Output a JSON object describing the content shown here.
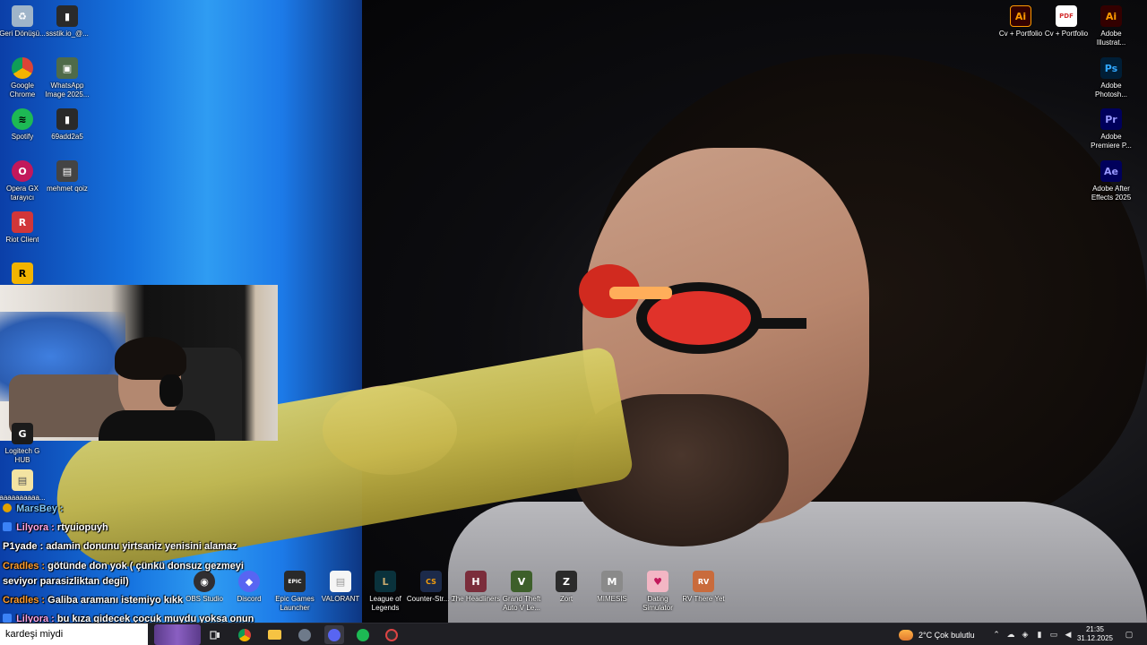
{
  "desktop_icons_left": [
    {
      "id": "recycle-bin",
      "label": "Geri Dönüşü...",
      "color": "#9fb4c9",
      "glyph": "♻"
    },
    {
      "id": "ssstik",
      "label": "ssstik.io_@...",
      "color": "#2a2a2a",
      "glyph": "▮"
    },
    {
      "id": "chrome",
      "label": "Google Chrome",
      "color": "#dd4b39",
      "glyph": "●"
    },
    {
      "id": "whatsapp-image",
      "label": "WhatsApp Image 2025...",
      "color": "#4f6b4a",
      "glyph": "▣"
    },
    {
      "id": "spotify",
      "label": "Spotify",
      "color": "#1db954",
      "glyph": "≋"
    },
    {
      "id": "image-69add2a5",
      "label": "69add2a5",
      "color": "#2a2a2a",
      "glyph": "▮"
    },
    {
      "id": "opera-gx",
      "label": "Opera GX tarayıcı",
      "color": "#c2185b",
      "glyph": "O"
    },
    {
      "id": "mehmet-qoiz",
      "label": "mehmet qoiz",
      "color": "#444",
      "glyph": "▤"
    },
    {
      "id": "riot-client",
      "label": "Riot Client",
      "color": "#d13639",
      "glyph": "R"
    },
    {
      "id": "rockstar",
      "label": "",
      "color": "#f2b400",
      "glyph": "R"
    },
    {
      "id": "logitech-ghub",
      "label": "Logitech G HUB",
      "color": "#1b1b1b",
      "glyph": "G"
    },
    {
      "id": "text-file",
      "label": "aaaaaaaaaa...",
      "color": "#f3e3a2",
      "glyph": "▤"
    }
  ],
  "desktop_icons_right": [
    {
      "id": "cv-portfolio-ai",
      "label": "Cv + Portfolio",
      "color": "#ff7c00",
      "glyph": "Ai"
    },
    {
      "id": "cv-portfolio-pdf",
      "label": "Cv + Portfolio",
      "color": "#d32f2f",
      "glyph": "PDF"
    },
    {
      "id": "adobe-illustrator",
      "label": "Adobe Illustrat...",
      "color": "#ff9a00",
      "glyph": "Ai"
    },
    {
      "id": "adobe-photoshop",
      "label": "Adobe Photosh...",
      "color": "#31a8ff",
      "glyph": "Ps"
    },
    {
      "id": "adobe-premiere",
      "label": "Adobe Premiere P...",
      "color": "#9999ff",
      "glyph": "Pr"
    },
    {
      "id": "adobe-after-effects",
      "label": "Adobe After Effects 2025",
      "color": "#9999ff",
      "glyph": "Ae"
    }
  ],
  "desktop_icons_bottom": [
    {
      "id": "obs-studio",
      "label": "OBS Studio",
      "color": "#302e31",
      "glyph": "◉"
    },
    {
      "id": "discord",
      "label": "Discord",
      "color": "#5865f2",
      "glyph": "◆"
    },
    {
      "id": "epic-games",
      "label": "Epic Games Launcher",
      "color": "#2a2a2a",
      "glyph": "EPIC"
    },
    {
      "id": "valorant",
      "label": "VALORANT",
      "color": "#f5f5f5",
      "glyph": "▤"
    },
    {
      "id": "league-of-legends",
      "label": "League of Legends",
      "color": "#0a323c",
      "glyph": "L"
    },
    {
      "id": "counter-strike-2",
      "label": "Counter-Str... 2",
      "color": "#f59e0b",
      "glyph": "CS"
    },
    {
      "id": "the-headliners",
      "label": "The Headliners",
      "color": "#7b2d3b",
      "glyph": "H"
    },
    {
      "id": "gta-v",
      "label": "Grand Theft Auto V Le...",
      "color": "#3d5f2a",
      "glyph": "V"
    },
    {
      "id": "zort",
      "label": "Zort",
      "color": "#2b2b2b",
      "glyph": "Z"
    },
    {
      "id": "mimesis",
      "label": "MIMESIS",
      "color": "#8a8a8a",
      "glyph": "M"
    },
    {
      "id": "dating-simulator",
      "label": "Dating Simulator",
      "color": "#f3b6c4",
      "glyph": "♥"
    },
    {
      "id": "rv-there-yet",
      "label": "RV There Yet",
      "color": "#c96b3c",
      "glyph": "RV"
    }
  ],
  "chat": [
    {
      "user": "MarsBey :",
      "user_color": "#7ec8ff",
      "badge_color": "#e0a100",
      "message": ""
    },
    {
      "user": "Lilyora :",
      "user_color": "#ffa6e6",
      "badge_color": "#3b82f6",
      "message": "rtyuiopuyh"
    },
    {
      "user": "P1yade :",
      "user_color": "#ffffff",
      "badge_color": "",
      "message": "adamin donunu yirtsaniz yenisini alamaz"
    },
    {
      "user": "Cradles :",
      "user_color": "#ff9d2e",
      "badge_color": "",
      "message": "götünde don yok ( çünkü donsuz gezmeyi"
    },
    {
      "user": "",
      "user_color": "#ffffff",
      "badge_color": "",
      "message": "seviyor parasizliktan degil)"
    },
    {
      "user": "Cradles :",
      "user_color": "#ff9d2e",
      "badge_color": "",
      "message": "Galiba aramanı istemiyo kıkk"
    },
    {
      "user": "Lilyora :",
      "user_color": "#ffa6e6",
      "badge_color": "#3b82f6",
      "message": "bu kıza gidecek çocuk muydu yoksa onun"
    },
    {
      "user": "",
      "user_color": "#ffffff",
      "badge_color": "",
      "message": "kardeşi miydi"
    }
  ],
  "taskbar": {
    "search_text": "kardeşi miydi",
    "weather_text": "2°C  Çok bulutlu",
    "time": "21:35",
    "date": "31.12.2025"
  }
}
